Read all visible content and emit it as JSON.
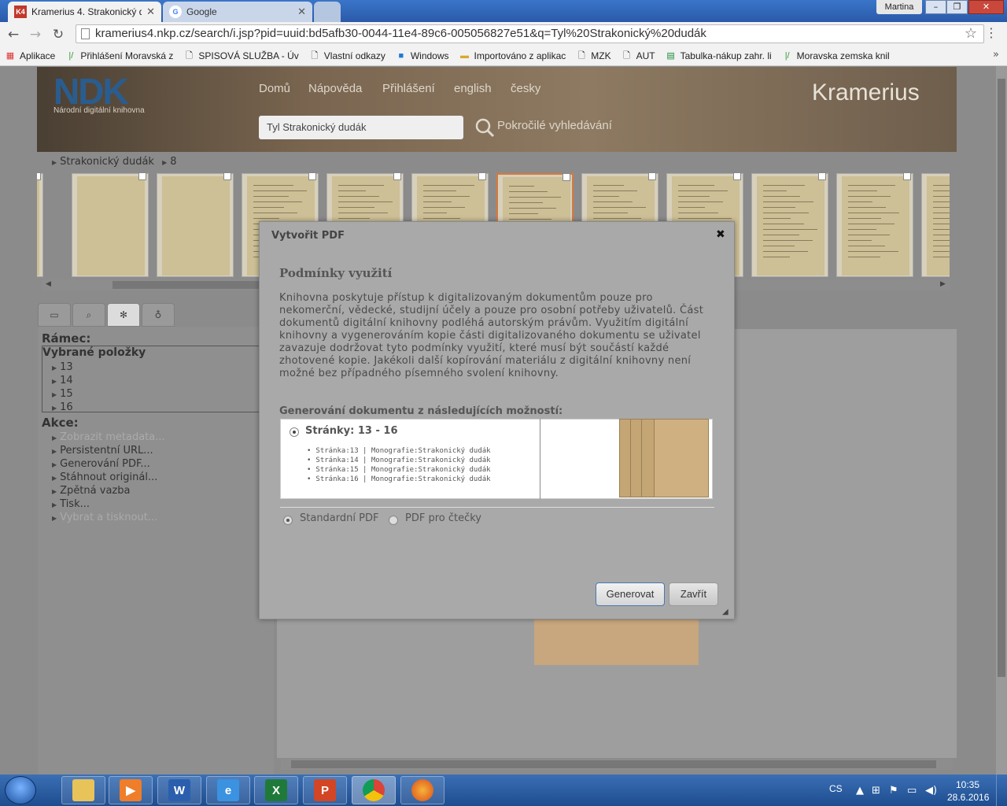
{
  "browser": {
    "tabs": [
      {
        "label": "Kramerius 4. Strakonický d",
        "favicon": "K4"
      },
      {
        "label": "Google",
        "favicon": "G"
      }
    ],
    "user": "Martina",
    "url": "kramerius4.nkp.cz/search/i.jsp?pid=uuid:bd5afb30-0044-11e4-89c6-005056827e51&q=Tyl%20Strakonický%20dudák",
    "bookmarks": [
      {
        "label": "Aplikace",
        "icon": "apps-icon"
      },
      {
        "label": "Přihlášení  Moravská z",
        "icon": "link-icon"
      },
      {
        "label": "SPISOVÁ SLUŽBA - Úv",
        "icon": "page-icon"
      },
      {
        "label": "Vlastní odkazy",
        "icon": "page-icon"
      },
      {
        "label": "Windows",
        "icon": "windows-icon"
      },
      {
        "label": "Importováno z aplikac",
        "icon": "folder-icon"
      },
      {
        "label": "MZK",
        "icon": "page-icon"
      },
      {
        "label": "AUT",
        "icon": "page-icon"
      },
      {
        "label": "Tabulka-nákup zahr. li",
        "icon": "sheet-icon"
      },
      {
        "label": "Moravska zemska knil",
        "icon": "link-icon"
      }
    ]
  },
  "site": {
    "logo_text": "NDK",
    "logo_tagline": "Národní digitální knihovna",
    "nav": [
      "Domů",
      "Nápověda",
      "Přihlášení",
      "english",
      "česky"
    ],
    "brand": "Kramerius",
    "search_value": "Tyl Strakonický dudák",
    "advanced_search": "Pokročilé vyhledávání",
    "breadcrumb": [
      "Strakonický dudák",
      "8"
    ]
  },
  "left_panel": {
    "tabs": [
      "folder-icon",
      "search-icon",
      "gear-icon",
      "bulb-icon"
    ],
    "frame_heading": "Rámec:",
    "selected_heading": "Vybrané položky",
    "selected_items": [
      "13",
      "14",
      "15",
      "16"
    ],
    "actions_heading": "Akce:",
    "actions": [
      {
        "label": "Zobrazit metadata...",
        "enabled": false
      },
      {
        "label": "Persistentní URL...",
        "enabled": true
      },
      {
        "label": "Generování PDF...",
        "enabled": true
      },
      {
        "label": "Stáhnout originál...",
        "enabled": true
      },
      {
        "label": "Zpětná vazba",
        "enabled": true
      },
      {
        "label": "Tisk...",
        "enabled": true
      },
      {
        "label": "Vybrat a tisknout...",
        "enabled": false
      }
    ]
  },
  "dialog": {
    "title": "Vytvořit PDF",
    "terms_heading": "Podmínky využití",
    "terms_lines": [
      "Knihovna poskytuje přístup k digitalizovaným dokumentům pouze pro",
      "nekomerční, vědecké, studijní účely a pouze pro osobní potřeby uživatelů. Část",
      "dokumentů digitální knihovny podléhá autorským právům. Využitím digitální",
      "knihovny a vygenerováním kopie části digitalizovaného dokumentu se uživatel",
      "zavazuje dodržovat tyto podmínky využití, které musí být součástí každé",
      "zhotovené kopie. Jakékoli další kopírování materiálu z digitální knihovny není",
      "možné bez případného písemného svolení knihovny."
    ],
    "generate_heading": "Generování dokumentu z následujících možností:",
    "range_label": "Stránky: 13 - 16",
    "pages": [
      "Stránka:13 | Monografie:Strakonický dudák",
      "Stránka:14 | Monografie:Strakonický dudák",
      "Stránka:15 | Monografie:Strakonický dudák",
      "Stránka:16 | Monografie:Strakonický dudák"
    ],
    "format_options": [
      {
        "label": "Standardní PDF",
        "selected": true
      },
      {
        "label": "PDF pro čtečky",
        "selected": false
      }
    ],
    "generate_button": "Generovat",
    "close_button": "Zavřít"
  },
  "taskbar": {
    "apps": [
      "explorer",
      "media-player",
      "word",
      "internet-explorer",
      "excel",
      "powerpoint",
      "chrome",
      "firefox"
    ],
    "language": "CS",
    "time": "10:35",
    "date": "28.6.2016"
  }
}
